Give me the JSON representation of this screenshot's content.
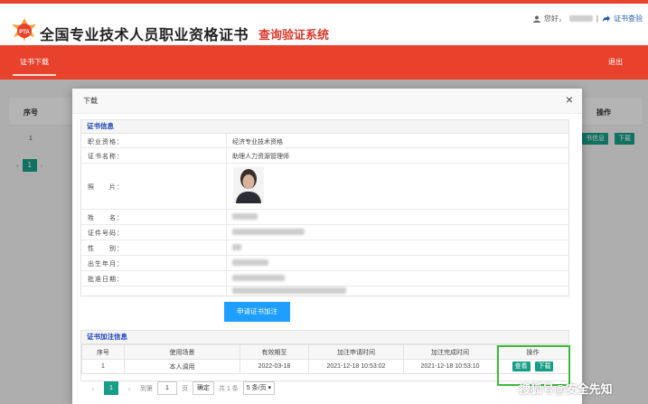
{
  "header": {
    "logo_text": "PTA",
    "title_main": "全国专业技术人员职业资格证书",
    "title_sub": "查询验证系统",
    "greeting": "您好，",
    "separator": "|",
    "cert_verify_link": "证书查验"
  },
  "nav": {
    "active_item": "证书下载",
    "logout": "退出"
  },
  "background_table": {
    "col_seq": "序号",
    "col_op": "操作",
    "row_num": "1",
    "btn_info": "书信息",
    "btn_download": "下载",
    "page_current": "1",
    "prev_arrow": "‹",
    "next_arrow": "›"
  },
  "modal": {
    "title": "下载",
    "close": "×",
    "cert_info": {
      "heading": "证书信息",
      "rows": [
        {
          "label": "职业资格：",
          "value": "经济专业技术资格"
        },
        {
          "label": "证书名称：",
          "value": "助理人力资源管理师"
        },
        {
          "label": "照　　片：",
          "value": ""
        },
        {
          "label": "姓　　名：",
          "value": ""
        },
        {
          "label": "证件号码：",
          "value": ""
        },
        {
          "label": "性　　别：",
          "value": ""
        },
        {
          "label": "出生年月：",
          "value": ""
        },
        {
          "label": "批准日期：",
          "value": ""
        },
        {
          "label": "",
          "value": ""
        }
      ]
    },
    "apply_button": "申请证书加注",
    "annotation": {
      "heading": "证书加注信息",
      "columns": [
        "序号",
        "使用场景",
        "有效期至",
        "加注申请时间",
        "加注完成时间",
        "操作"
      ],
      "rows": [
        {
          "seq": "1",
          "scene": "本人调用",
          "valid_until": "2022-03-18",
          "apply_time": "2021-12-18 10:53:02",
          "complete_time": "2021-12-18 10:53:10",
          "view": "查看",
          "download": "下载"
        }
      ]
    },
    "pager": {
      "prev": "‹",
      "current": "1",
      "next": "›",
      "goto_label": "到第",
      "goto_value": "1",
      "page_unit": "页",
      "confirm": "确定",
      "total": "共 1 条",
      "page_size": "5 条/页 ▾"
    }
  },
  "watermark": "搜狐号@安全先知",
  "colors": {
    "brand_red": "#e8412c",
    "teal_button": "#179e86",
    "primary_blue": "#1e9fff",
    "highlight_green": "#3dbb3d",
    "section_blue": "#1a3fb8"
  }
}
